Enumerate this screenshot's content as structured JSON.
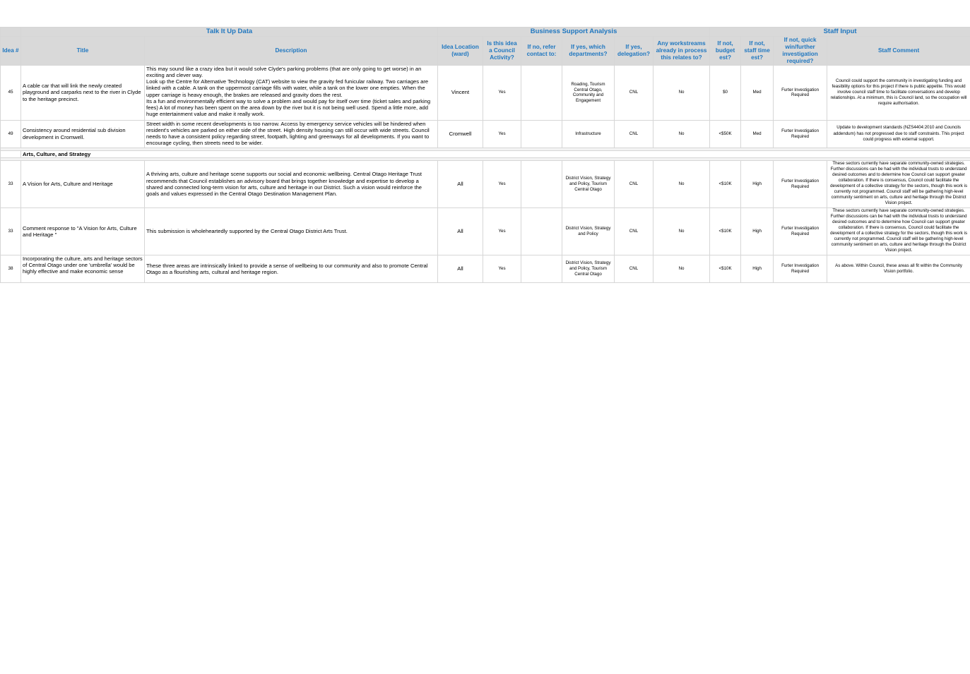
{
  "groups": {
    "talk_it_up": "Talk It Up Data",
    "business_support": "Business Support Analysis",
    "staff_input": "Staff Input"
  },
  "columns": {
    "idea": "Idea #",
    "title": "Title",
    "description": "Description",
    "location": "Idea Location (ward)",
    "council_activity": "Is this idea a Council Activity?",
    "refer_contact": "If no, refer contact to:",
    "departments": "If yes, which departments?",
    "delegation": "If yes, delegation?",
    "workstreams": "Any workstreams already in process this relates to?",
    "budget": "If not, budget est?",
    "staff_time": "If not, staff time est?",
    "quick_win": "If not, quick win/further investigation required?",
    "staff_comment": "Staff Comment"
  },
  "rows": [
    {
      "idea": "45",
      "title": "A cable car that will link the newly created playground and carparks next to the river in Clyde to the heritage precinct.",
      "description": "This may sound like a crazy idea but it would solve Clyde's parking problems (that are only going to get worse) in an exciting and clever way.\n Look up the Centre for Alternative Technology (CAT) website to view the gravity fed funicular railway. Two carriages are linked with a cable. A tank on the uppermost carriage fills with water, while a tank on the lower one empties. When the upper carriage is heavy enough, the brakes are released and gravity does the rest.\nIts a fun and environmentally efficient way to solve a problem and would pay for itself over time (ticket sales and parking fees) A lot of money has been spent on the area down by the river but it is not being well used. Spend a little more, add huge entertainment value and make it really work.",
      "location": "Vincent",
      "council_activity": "Yes",
      "refer_contact": "",
      "departments": "Roading, Tourism Central Otago, Community and Engagement",
      "delegation": "CNL",
      "workstreams": "No",
      "budget": "$0",
      "staff_time": "Med",
      "quick_win": "Furter Investigation Required",
      "staff_comment": "Council could support the community in investigating funding and feasibility options for this project if there is public appetite. This would involve council staff time to facilitate conversations and develop relationships. At a minimum, this is Council land, so the occupation will require authorisation."
    },
    {
      "idea": "49",
      "title": "Consistency around residential sub division development in Cromwell.",
      "description": "Street width in some recent developments is too narrow.  Access by emergency service vehicles will be hindered when resident's vehicles are parked on either side of the street.  High density housing can still occur with wide streets.  Council needs to have a consistent policy regarding street, footpath, lighting and greenways for all developments.  If you want to encourage cycling, then streets need to be wider.",
      "location": "Cromwell",
      "council_activity": "Yes",
      "refer_contact": "",
      "departments": "Infrastructure",
      "delegation": "CNL",
      "workstreams": "No",
      "budget": "<$50K",
      "staff_time": "Med",
      "quick_win": "Furter Investigation Required",
      "staff_comment": "Update to development standards (NZS4404:2010 and Councils addendum) has not progressed due to staff constraints. This project could progress with external support."
    }
  ],
  "section": {
    "label": "Arts, Culture, and Strategy"
  },
  "section_rows": [
    {
      "idea": "33",
      "title": "A Vision for Arts, Culture and Heritage",
      "description": "A thriving arts, culture and heritage scene supports our social and economic wellbeing. Central Otago Heritage Trust recommends that Council establishes an advisory board that brings together knowledge and expertise to develop a shared and connected long-term vision for arts, culture and heritage in our District. Such a vision would reinforce the goals and values expressed in the Central Otago Destination Management Plan.",
      "location": "All",
      "council_activity": "Yes",
      "refer_contact": "",
      "departments": "District Vision, Strategy and Policy, Tourism Central Otago",
      "delegation": "CNL",
      "workstreams": "No",
      "budget": "<$10K",
      "staff_time": "High",
      "quick_win": "Furter Investigation Required",
      "staff_comment": "These sectors currently have separate community-owned strategies. Further discussions can be had with the individual trusts to understand desired outcomes and to determine how Council can support greater collaboration. If there is consensus, Council could facilitate the development of a collective strategy for the sectors, though this work is currently not programmed. Council staff will be gathering high-level community sentiment on arts, culture and heritage through the District Vision project."
    },
    {
      "idea": "33",
      "title": "Comment response to \"A Vision for Arts, Culture and Heritage \"",
      "description": "This submission is wholeheartedly supported by the Central Otago District Arts Trust.",
      "location": "All",
      "council_activity": "Yes",
      "refer_contact": "",
      "departments": "District Vision, Strategy and Policy",
      "delegation": "CNL",
      "workstreams": "No",
      "budget": "<$10K",
      "staff_time": "High",
      "quick_win": "Furter Investigation Required",
      "staff_comment": "These sectors currently have separate community-owned strategies. Further discussions can be had with the individual trusts to understand desired outcomes and to determine how Council can support greater collaboration. If there is consensus, Council could facilitate the development of a collective strategy for the sectors, though this work is currently not programmed. Council staff will be gathering high-level community sentiment on arts, culture and heritage through the District Vision project."
    },
    {
      "idea": "38",
      "title": "Incorporating the culture, arts and heritage sectors of Central Otago under one 'umbrella' would be highly effective and make economic sense",
      "description": "These three areas are intrinsically linked to provide a sense of wellbeing to our community and also to promote Central Otago as a flourishing arts, cultural and heritage region.",
      "location": "All",
      "council_activity": "Yes",
      "refer_contact": "",
      "departments": "District Vision, Strategy and Policy, Tourism Central Otago",
      "delegation": "CNL",
      "workstreams": "No",
      "budget": "<$10K",
      "staff_time": "High",
      "quick_win": "Furter Investigation Required",
      "staff_comment": "As above. Within Council, these areas all fit within the Community Vision portfolio."
    }
  ]
}
